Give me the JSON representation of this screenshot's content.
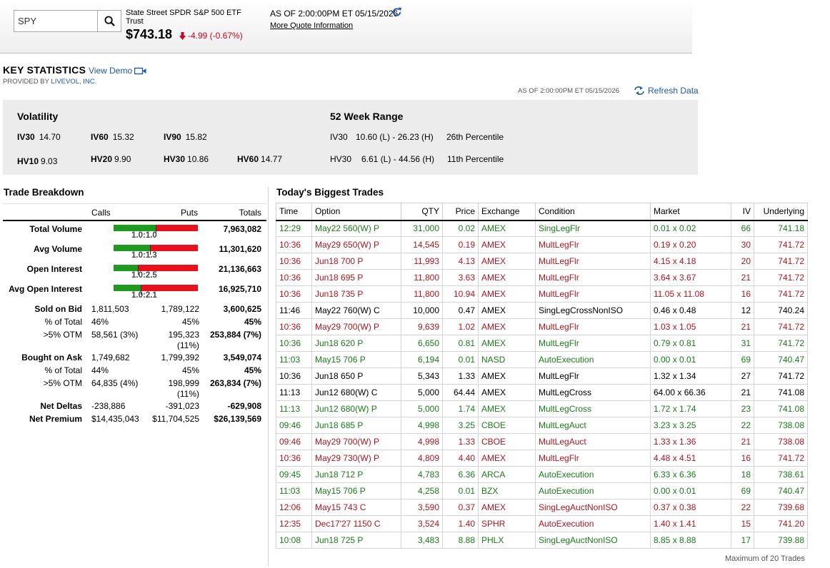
{
  "header": {
    "search_value": "SPY",
    "security_name": "State Street SPDR S&P 500 ETF Trust",
    "price": "$743.18",
    "change": "-4.99 (-0.67%)",
    "as_of": "AS OF 2:00:00PM ET 05/15/2026",
    "more_quote": "More Quote Information"
  },
  "key_statistics": {
    "title": "KEY STATISTICS",
    "view_demo": "View Demo",
    "provided_by": "PROVIDED BY",
    "provider": "LIVEVOL, INC.",
    "as_of": "AS OF 2:00:00PM ET 05/15/2026",
    "refresh": "Refresh Data"
  },
  "volatility": {
    "heading": "Volatility",
    "iv30_label": "IV30",
    "iv30": "14.70",
    "iv60_label": "IV60",
    "iv60": "15.32",
    "iv90_label": "IV90",
    "iv90": "15.82",
    "hv10_label": "HV10",
    "hv10": "9.03",
    "hv20_label": "HV20",
    "hv20": "9.90",
    "hv30_label": "HV30",
    "hv30": "10.86",
    "hv60_label": "HV60",
    "hv60": "14.77"
  },
  "week52": {
    "heading": "52 Week Range",
    "iv30_label": "IV30",
    "iv30_range": "10.60 (L) - 26.23 (H)",
    "iv30_pct": "26th  Percentile",
    "hv30_label": "HV30",
    "hv30_range": "6.61 (L) - 44.56 (H)",
    "hv30_pct": "11th  Percentile"
  },
  "trade_breakdown": {
    "title": "Trade Breakdown",
    "headers": {
      "calls": "Calls",
      "puts": "Puts",
      "totals": "Totals"
    },
    "total_volume": {
      "label": "Total Volume",
      "ratio": "1.0:1.0",
      "call_share": 0.5,
      "total": "7,963,082"
    },
    "avg_volume": {
      "label": "Avg Volume",
      "ratio": "1.0:1.3",
      "call_share": 0.43,
      "total": "11,301,620"
    },
    "open_interest": {
      "label": "Open Interest",
      "ratio": "1.0:2.5",
      "call_share": 0.29,
      "total": "21,136,663"
    },
    "avg_open_interest": {
      "label": "Avg Open Interest",
      "ratio": "1.0:2.1",
      "call_share": 0.32,
      "total": "16,925,710"
    },
    "sold_on_bid": {
      "label": "Sold on Bid",
      "calls": "1,811,503",
      "puts": "1,789,122",
      "total": "3,600,625"
    },
    "sold_pct": {
      "label": "% of Total",
      "calls": "46%",
      "puts": "45%",
      "total": "45%"
    },
    "sold_otm": {
      "label": ">5% OTM",
      "calls": "58,561 (3%)",
      "puts": "195,323",
      "puts2": "(11%)",
      "total": "253,884 (7%)"
    },
    "bought_on_ask": {
      "label": "Bought on Ask",
      "calls": "1,749,682",
      "puts": "1,799,392",
      "total": "3,549,074"
    },
    "bought_pct": {
      "label": "% of Total",
      "calls": "44%",
      "puts": "45%",
      "total": "45%"
    },
    "bought_otm": {
      "label": ">5% OTM",
      "calls": "64,835 (4%)",
      "puts": "198,999",
      "puts2": "(11%)",
      "total": "263,834 (7%)"
    },
    "net_deltas": {
      "label": "Net Deltas",
      "calls": "-238,886",
      "puts": "-391,023",
      "total": "-629,908"
    },
    "net_premium": {
      "label": "Net Premium",
      "calls": "$14,435,043",
      "puts": "$11,704,525",
      "total": "$26,139,569"
    }
  },
  "biggest_trades": {
    "title": "Today's Biggest Trades",
    "columns": [
      "Time",
      "Option",
      "QTY",
      "Price",
      "Exchange",
      "Condition",
      "Market",
      "IV",
      "Underlying"
    ],
    "footer": "Maximum of 20 Trades",
    "colors": {
      "green": "#1a7d1a",
      "red": "#b3151f",
      "black": "#000000"
    },
    "rows": [
      {
        "color": "green",
        "cells": [
          "12:29",
          "May22 560(W) P",
          "31,000",
          "0.02",
          "AMEX",
          "SingLegFlr",
          "0.01 x 0.02",
          "66",
          "741.18"
        ]
      },
      {
        "color": "red",
        "cells": [
          "10:36",
          "May29 650(W) P",
          "14,545",
          "0.19",
          "AMEX",
          "MultLegFlr",
          "0.19 x 0.20",
          "30",
          "741.72"
        ]
      },
      {
        "color": "red",
        "cells": [
          "10:36",
          "Jun18 700 P",
          "11,993",
          "4.13",
          "AMEX",
          "MultLegFlr",
          "4.15 x 4.18",
          "20",
          "741.72"
        ]
      },
      {
        "color": "red",
        "cells": [
          "10:36",
          "Jun18 695 P",
          "11,800",
          "3.63",
          "AMEX",
          "MultLegFlr",
          "3.64 x 3.67",
          "21",
          "741.72"
        ]
      },
      {
        "color": "red",
        "cells": [
          "10:36",
          "Jun18 735 P",
          "11,800",
          "10.94",
          "AMEX",
          "MultLegFlr",
          "11.05 x 11.08",
          "16",
          "741.72"
        ]
      },
      {
        "color": "black",
        "cells": [
          "11:46",
          "May22 760(W) C",
          "10,000",
          "0.47",
          "AMEX",
          "SingLegCrossNonISO",
          "0.46 x 0.48",
          "12",
          "740.24"
        ]
      },
      {
        "color": "red",
        "cells": [
          "10:36",
          "May29 700(W) P",
          "9,639",
          "1.02",
          "AMEX",
          "MultLegFlr",
          "1.03 x 1.05",
          "21",
          "741.72"
        ]
      },
      {
        "color": "green",
        "cells": [
          "10:36",
          "Jun18 620 P",
          "6,650",
          "0.81",
          "AMEX",
          "MultLegFlr",
          "0.79 x 0.81",
          "31",
          "741.72"
        ]
      },
      {
        "color": "green",
        "cells": [
          "11:03",
          "May15 706 P",
          "6,194",
          "0.01",
          "NASD",
          "AutoExecution",
          "0.00 x 0.01",
          "69",
          "740.47"
        ]
      },
      {
        "color": "black",
        "cells": [
          "10:36",
          "Jun18 650 P",
          "5,343",
          "1.33",
          "AMEX",
          "MultLegFlr",
          "1.32 x 1.34",
          "27",
          "741.72"
        ]
      },
      {
        "color": "black",
        "cells": [
          "11:13",
          "Jun12 680(W) C",
          "5,000",
          "64.44",
          "AMEX",
          "MultLegCross",
          "64.00 x 66.36",
          "21",
          "741.08"
        ]
      },
      {
        "color": "green",
        "cells": [
          "11:13",
          "Jun12 680(W) P",
          "5,000",
          "1.74",
          "AMEX",
          "MultLegCross",
          "1.72 x 1.74",
          "23",
          "741.08"
        ]
      },
      {
        "color": "green",
        "cells": [
          "09:46",
          "Jun18 685 P",
          "4,998",
          "3.25",
          "CBOE",
          "MultLegAuct",
          "3.23 x 3.25",
          "22",
          "738.08"
        ]
      },
      {
        "color": "red",
        "cells": [
          "09:46",
          "May29 700(W) P",
          "4,998",
          "1.33",
          "CBOE",
          "MultLegAuct",
          "1.33 x 1.36",
          "21",
          "738.08"
        ]
      },
      {
        "color": "red",
        "cells": [
          "10:36",
          "May29 730(W) P",
          "4,809",
          "4.40",
          "AMEX",
          "MultLegFlr",
          "4.48 x 4.51",
          "16",
          "741.72"
        ]
      },
      {
        "color": "green",
        "cells": [
          "09:45",
          "Jun18 712 P",
          "4,783",
          "6.36",
          "ARCA",
          "AutoExecution",
          "6.33 x 6.36",
          "18",
          "738.61"
        ]
      },
      {
        "color": "green",
        "cells": [
          "11:03",
          "May15 706 P",
          "4,258",
          "0.01",
          "BZX",
          "AutoExecution",
          "0.00 x 0.01",
          "69",
          "740.47"
        ]
      },
      {
        "color": "red",
        "cells": [
          "12:06",
          "May15 743 C",
          "3,590",
          "0.37",
          "AMEX",
          "SingLegAuctNonISO",
          "0.37 x 0.38",
          "22",
          "739.68"
        ]
      },
      {
        "color": "red",
        "cells": [
          "12:35",
          "Dec17'27 1150 C",
          "3,524",
          "1.40",
          "SPHR",
          "AutoExecution",
          "1.40 x 1.41",
          "15",
          "741.20"
        ]
      },
      {
        "color": "green",
        "cells": [
          "10:08",
          "Jun18 725 P",
          "3,483",
          "8.88",
          "PHLX",
          "SingLegAuctNonISO",
          "8.85 x 8.88",
          "17",
          "739.88"
        ]
      }
    ]
  }
}
